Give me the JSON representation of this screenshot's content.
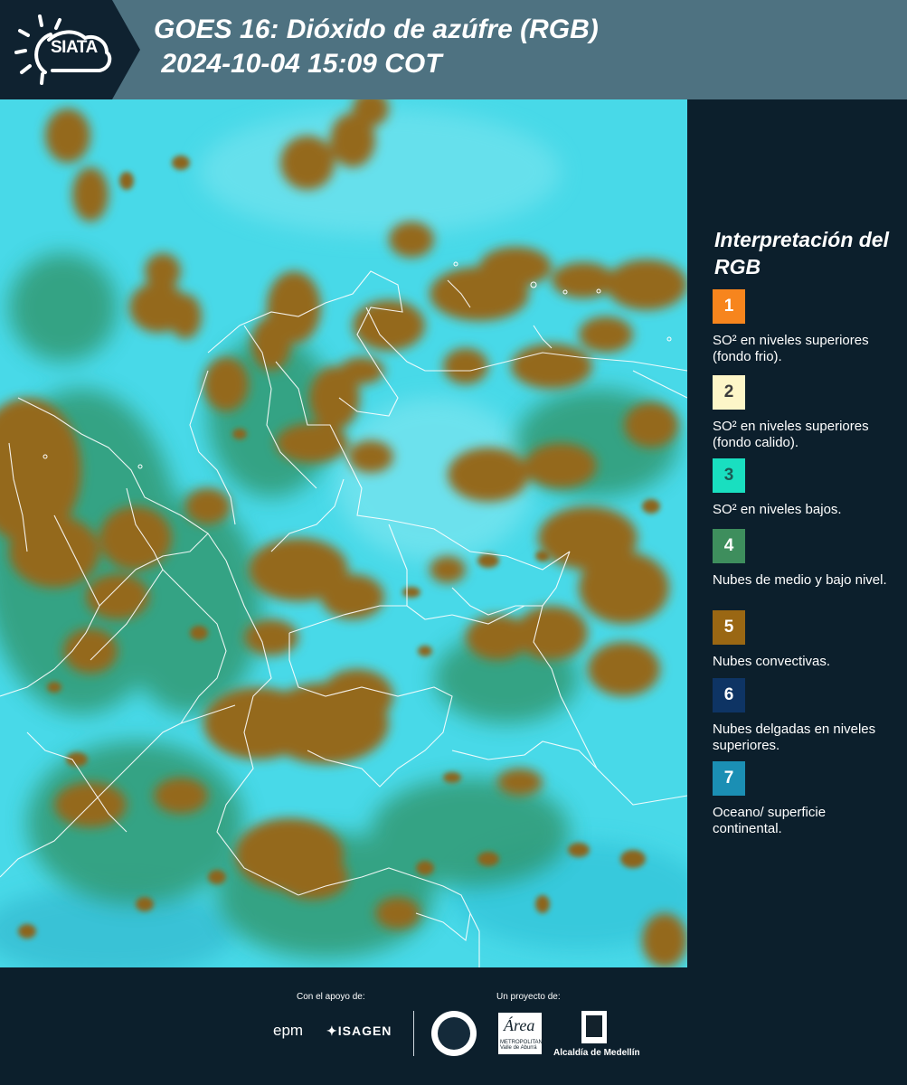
{
  "header": {
    "logo_text": "SIATA",
    "title": "GOES 16: Dióxido de azúfre (RGB)\n 2024-10-04 15:09 COT"
  },
  "legend": {
    "title": "Interpretación del RGB",
    "items": [
      {
        "number": "1",
        "color": "#f7851d",
        "text_color": "#ffffff",
        "label": "SO² en niveles superiores (fondo frio)."
      },
      {
        "number": "2",
        "color": "#fdf6c8",
        "text_color": "#3b3b3b",
        "label": "SO² en niveles superiores (fondo calido)."
      },
      {
        "number": "3",
        "color": "#19dfc0",
        "text_color": "#1b5c55",
        "label": "SO² en niveles bajos."
      },
      {
        "number": "4",
        "color": "#3e8e5d",
        "text_color": "#ffffff",
        "label": "Nubes de medio y bajo nivel."
      },
      {
        "number": "5",
        "color": "#9a6713",
        "text_color": "#ffffff",
        "label": "Nubes convectivas."
      },
      {
        "number": "6",
        "color": "#0e3464",
        "text_color": "#ffffff",
        "label": "Nubes delgadas en niveles superiores."
      },
      {
        "number": "7",
        "color": "#1b8fb4",
        "text_color": "#ffffff",
        "label": "Oceano/ superficie continental."
      }
    ]
  },
  "footer": {
    "support_label": "Con el apoyo de:",
    "project_label": "Un proyecto de:",
    "sponsors": [
      "epm",
      "ISAGEN"
    ],
    "area_metropolitana": "Área",
    "area_sub": "METROPOLITANA Valle de Aburrá",
    "alcaldia": "Alcaldía de Medellín"
  },
  "map_colors": {
    "background": "#48d9e8",
    "convective": "#94691c",
    "mid_level": "#2f9163",
    "borders": "#ffffff"
  }
}
